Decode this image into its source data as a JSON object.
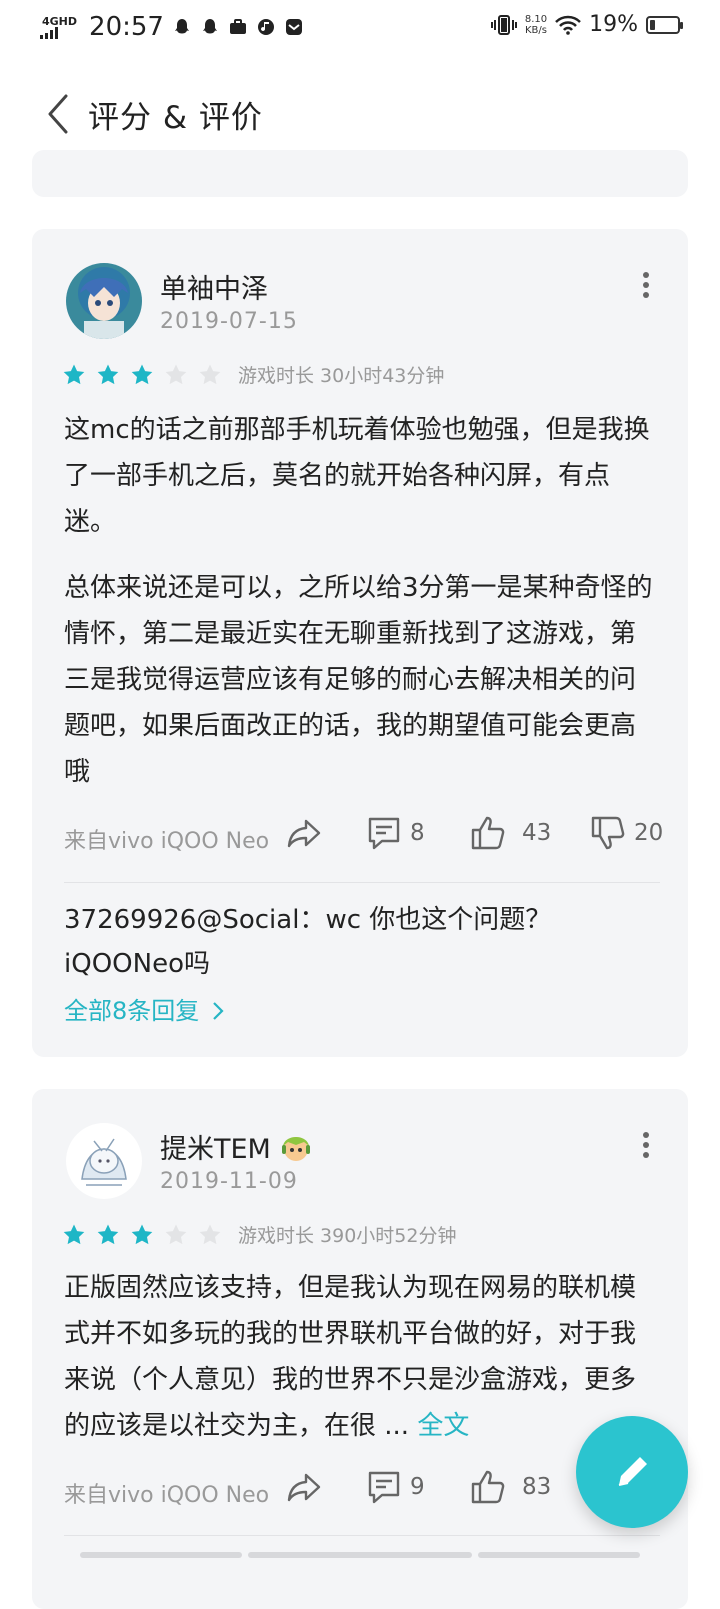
{
  "status_bar": {
    "network": "4GHD",
    "time": "20:57",
    "net_speed_value": "8.10",
    "net_speed_unit": "KB/s",
    "battery_text": "19%",
    "battery_level": 0.19
  },
  "nav": {
    "title": "评分 & 评价"
  },
  "reviews": [
    {
      "user": "单袖中泽",
      "date": "2019-07-15",
      "rating": 3,
      "max_rating": 5,
      "playtime": "游戏时长 30小时43分钟",
      "paragraphs": [
        "这mc的话之前那部手机玩着体验也勉强，但是我换了一部手机之后，莫名的就开始各种闪屏，有点迷。",
        "总体来说还是可以，之所以给3分第一是某种奇怪的情怀，第二是最近实在无聊重新找到了这游戏，第三是我觉得运营应该有足够的耐心去解决相关的问题吧，如果后面改正的话，我的期望值可能会更高哦"
      ],
      "device": "来自vivo iQOO Neo",
      "comments": "8",
      "likes": "43",
      "dislikes": "20",
      "reply_user": "37269926@Social",
      "reply_sep": "：",
      "reply_text": "wc 你也这个问题？iQOONeo吗",
      "all_replies": "全部8条回复"
    },
    {
      "user": "提米TEM",
      "date": "2019-11-09",
      "rating": 3,
      "max_rating": 5,
      "playtime": "游戏时长 390小时52分钟",
      "paragraph": "正版固然应该支持，但是我认为现在网易的联机模式并不如多玩的我的世界联机平台做的好，对于我来说（个人意见）我的世界不只是沙盒游戏，更多的应该是以社交为主，在很 ...",
      "full_text_link": "全文",
      "device": "来自vivo iQOO Neo",
      "comments": "9",
      "likes": "83"
    }
  ],
  "colors": {
    "accent": "#2bc4cf",
    "link": "#26b5c4",
    "star_on": "#1eb6c6",
    "star_off": "#e3e4e6",
    "card_bg": "#f4f5f7"
  },
  "icons": {
    "back": "chevron-left-icon",
    "more": "more-vertical-icon",
    "share": "share-icon",
    "comment": "comment-icon",
    "like": "thumbs-up-icon",
    "dislike": "thumbs-down-icon",
    "compose": "pencil-icon"
  }
}
